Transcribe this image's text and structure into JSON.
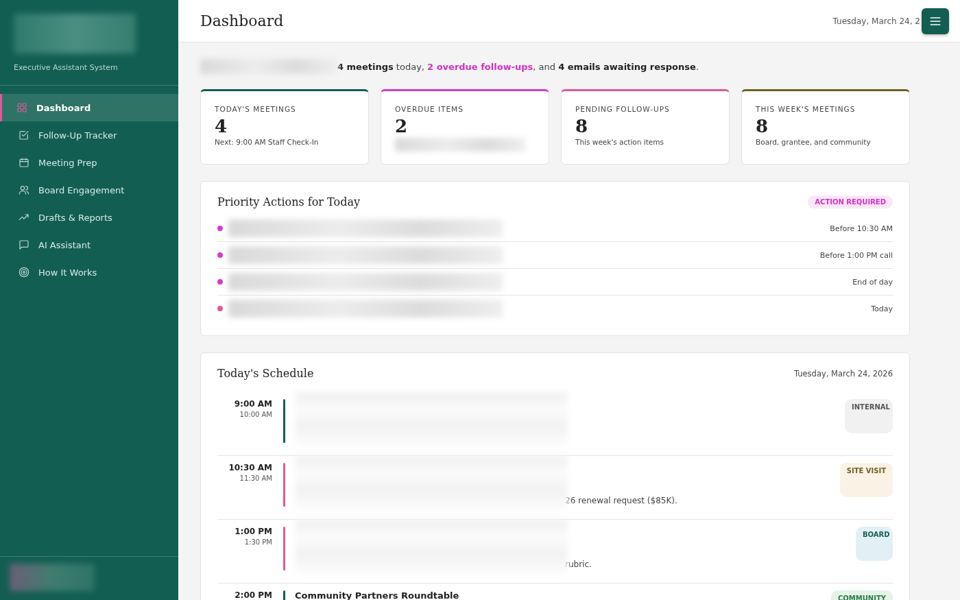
{
  "sidebar": {
    "logo": {
      "kind": "redacted"
    },
    "subtitle": "Executive Assistant System",
    "items": [
      {
        "label": "Dashboard",
        "selected": true
      },
      {
        "label": "Follow-Up Tracker",
        "selected": false
      },
      {
        "label": "Meeting Prep",
        "selected": false
      },
      {
        "label": "Board Engagement",
        "selected": false
      },
      {
        "label": "Drafts & Reports",
        "selected": false
      },
      {
        "label": "AI Assistant",
        "selected": false
      },
      {
        "label": "How It Works",
        "selected": false
      }
    ],
    "user": {
      "kind": "redacted"
    }
  },
  "header": {
    "title": "Dashboard",
    "date": "Tuesday, March 24, 2"
  },
  "summary": [
    {
      "kind": "redacted"
    },
    {
      "kind": "bold",
      "text": "4 meetings"
    },
    {
      "kind": "plain",
      "text": " today, "
    },
    {
      "kind": "alert",
      "text": "2 overdue follow-ups"
    },
    {
      "kind": "plain",
      "text": ", and "
    },
    {
      "kind": "bold",
      "text": "4 emails awaiting response"
    },
    {
      "kind": "plain",
      "text": "."
    }
  ],
  "stats": [
    {
      "label": "TODAY'S MEETINGS",
      "value": "4",
      "note": "Next: 9:00 AM Staff Check-In",
      "color": "#135e52"
    },
    {
      "label": "OVERDUE ITEMS",
      "value": "2",
      "color": "#d63ad0"
    },
    {
      "label": "PENDING FOLLOW-UPS",
      "value": "8",
      "note": "This week's action items",
      "color": "#e0589a"
    },
    {
      "label": "THIS WEEK'S MEETINGS",
      "value": "8",
      "note": "Board, grantee, and community",
      "color": "#6b6224"
    }
  ],
  "priority": {
    "title": "Priority Actions for Today",
    "badge": "ACTION REQUIRED",
    "items": [
      {
        "when": "Before 10:30 AM",
        "color": "#d63ad0"
      },
      {
        "when": "Before 1:00 PM call",
        "color": "#d63ad0"
      },
      {
        "when": "End of day",
        "color": "#d63ad0"
      },
      {
        "when": "Today",
        "color": "#e0589a"
      }
    ]
  },
  "schedule": {
    "title": "Today's Schedule",
    "date": "Tuesday, March 24, 2026",
    "items": [
      {
        "start": "9:00 AM",
        "end": "10:00 AM",
        "color": "#135e52",
        "tag": "INTERNAL",
        "kind": "internal"
      },
      {
        "start": "10:30 AM",
        "end": "11:30 AM",
        "color": "#e0589a",
        "detail": "26 renewal request ($85K).",
        "tag": "SITE VISIT",
        "kind": "site"
      },
      {
        "start": "1:00 PM",
        "end": "1:30 PM",
        "color": "#e0589a",
        "detail": "rubric.",
        "tag": "BOARD",
        "kind": "board"
      },
      {
        "start": "2:00 PM",
        "color": "#135e52",
        "title": "Community Partners Roundtable",
        "tag": "COMMUNITY",
        "kind": "community"
      }
    ]
  }
}
